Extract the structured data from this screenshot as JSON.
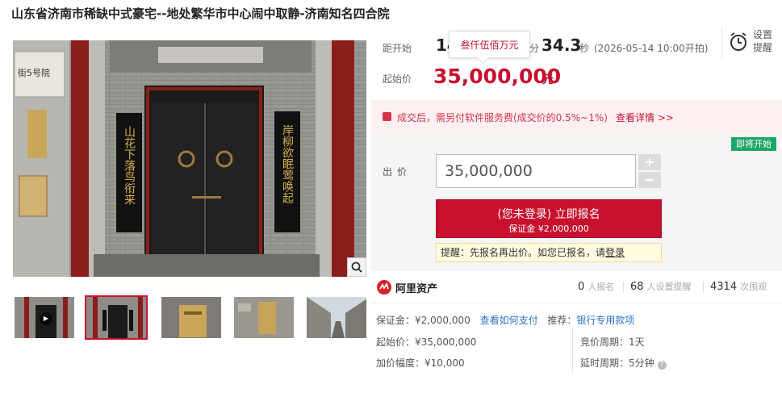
{
  "title": "山东省济南市稀缺中式豪宅--地处繁华市中心闹中取静-济南知名四合院",
  "countdown": {
    "label": "距开始",
    "num1": "14",
    "unit_min": "分",
    "seconds": "34.3",
    "unit_sec": "秒",
    "start_time": "(2026-05-14 10:00开拍)"
  },
  "tooltip": "叁仟伍佰万元",
  "remind": {
    "line1": "设置",
    "line2": "提醒"
  },
  "start_price": {
    "label": "起始价",
    "value": "35,000,000",
    "unit": "元"
  },
  "notice": {
    "text": "成交后，需另付软件服务费(成交价的0.5%~1%)",
    "link": "查看详情 >>"
  },
  "status_badge": "即将开始",
  "bid": {
    "label": "出价",
    "value": "35,000,000",
    "plus": "+",
    "minus": "−",
    "register_line1": "(您未登录) 立即报名",
    "register_line2": "保证金 ¥2,000,000",
    "tip_prefix": "提醒：先报名再出价。如您已报名，请",
    "tip_link": "登录"
  },
  "platform": {
    "name": "阿里资产"
  },
  "stats": [
    {
      "num": "0",
      "label": "人报名"
    },
    {
      "num": "68",
      "label": "人设置提醒"
    },
    {
      "num": "4314",
      "label": "次围观"
    }
  ],
  "details": {
    "deposit_label": "保证金：",
    "deposit_value": "¥2,000,000",
    "how_to_pay": "查看如何支付",
    "recommend_label": "推荐：",
    "recommend_link": "银行专用款项",
    "start_price_label": "起始价：",
    "start_price_value": "¥35,000,000",
    "increment_label": "加价幅度：",
    "increment_value": "¥10,000",
    "cycle_label": "竞价周期：",
    "cycle_value": "1天",
    "extend_label": "延时周期：",
    "extend_value": "5分钟"
  },
  "main_photo": {
    "left_scroll": "山花下落鸟衔来",
    "right_scroll": "岸柳欲眠莺唤起",
    "plaque": "街5号院"
  },
  "colors": {
    "accent": "#c8102e",
    "badge": "#1fa567",
    "link": "#2d73c7"
  }
}
